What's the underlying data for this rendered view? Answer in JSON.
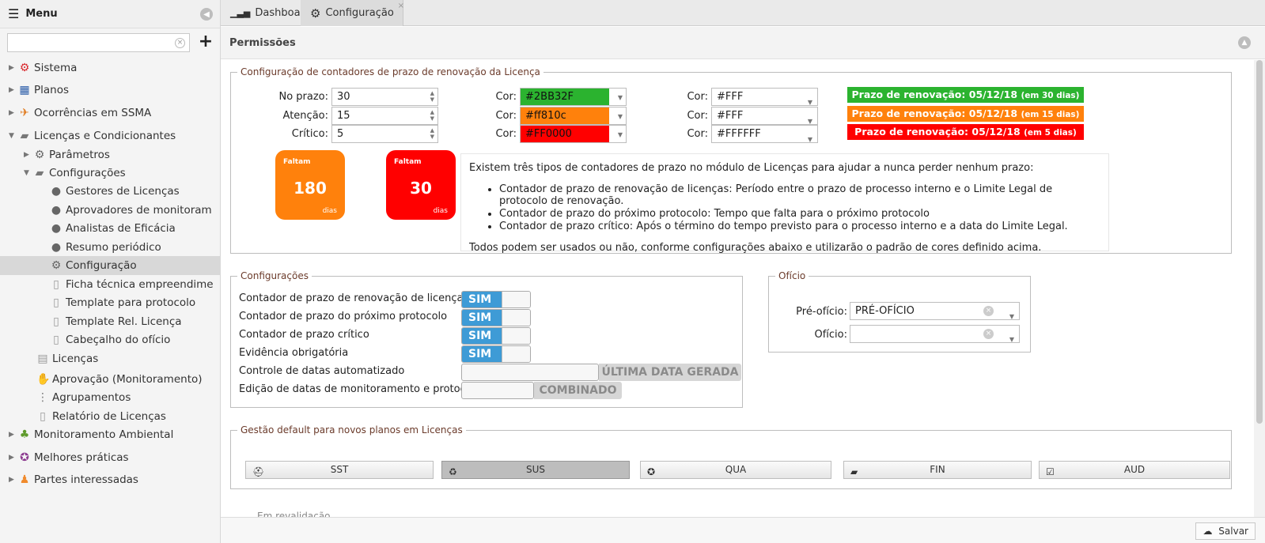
{
  "sidebar": {
    "menu_label": "Menu",
    "search_placeholder": "",
    "items": [
      {
        "label": "Sistema",
        "icon": "gear-red-icon",
        "color": "#d9262b",
        "level": 0,
        "arrow": "right"
      },
      {
        "label": "Planos",
        "icon": "calendar-icon",
        "color": "#2a5ca8",
        "level": 0,
        "arrow": "right"
      },
      {
        "label": "Ocorrências em SSMA",
        "icon": "fall-person-icon",
        "color": "#e07b1f",
        "level": 0,
        "arrow": "right"
      },
      {
        "label": "Licenças e Condicionantes",
        "icon": "folder-open-icon",
        "color": "#777777",
        "level": 0,
        "arrow": "down"
      },
      {
        "label": "Parâmetros",
        "icon": "gear-icon",
        "color": "#666666",
        "level": 1,
        "arrow": "right"
      },
      {
        "label": "Configurações",
        "icon": "folder-open-icon",
        "color": "#777777",
        "level": 1,
        "arrow": "down"
      },
      {
        "label": "Gestores de Licenças",
        "icon": "user-icon",
        "color": "#666666",
        "level": 2
      },
      {
        "label": "Aprovadores de monitoram",
        "icon": "user-icon",
        "color": "#666666",
        "level": 2
      },
      {
        "label": "Analistas de Eficácia",
        "icon": "user-icon",
        "color": "#666666",
        "level": 2
      },
      {
        "label": "Resumo periódico",
        "icon": "user-clock-icon",
        "color": "#666666",
        "level": 2
      },
      {
        "label": "Configuração",
        "icon": "gear-icon",
        "color": "#666666",
        "level": 2,
        "selected": true
      },
      {
        "label": "Ficha técnica empreendime",
        "icon": "pdf-icon",
        "color": "#999999",
        "level": 2
      },
      {
        "label": "Template para protocolo",
        "icon": "pdf-icon",
        "color": "#999999",
        "level": 2
      },
      {
        "label": "Template Rel. Licença",
        "icon": "pdf-icon",
        "color": "#999999",
        "level": 2
      },
      {
        "label": "Cabeçalho do ofício",
        "icon": "pdf-icon",
        "color": "#999999",
        "level": 2
      },
      {
        "label": "Licenças",
        "icon": "license-doc-icon",
        "color": "#999999",
        "level": 1
      },
      {
        "label": "Aprovação (Monitoramento)",
        "icon": "thumbs-up-icon",
        "color": "#777777",
        "level": 1
      },
      {
        "label": "Agrupamentos",
        "icon": "group-icon",
        "color": "#777777",
        "level": 1
      },
      {
        "label": "Relatório de Licenças",
        "icon": "pdf-icon",
        "color": "#999999",
        "level": 1
      },
      {
        "label": "Monitoramento Ambiental",
        "icon": "tree-icon",
        "color": "#5e9a2b",
        "level": 0,
        "arrow": "right"
      },
      {
        "label": "Melhores práticas",
        "icon": "medal-icon",
        "color": "#8b3a8f",
        "level": 0,
        "arrow": "right"
      },
      {
        "label": "Partes interessadas",
        "icon": "people-icon",
        "color": "#f08a2c",
        "level": 0,
        "arrow": "right"
      }
    ]
  },
  "tabs": [
    {
      "label": "Dashboard",
      "icon": "bar-chart-icon"
    },
    {
      "label": "Configuração",
      "icon": "gear-icon",
      "close": "×"
    }
  ],
  "panel": {
    "title": "Permissões"
  },
  "counters": {
    "legend": "Configuração de contadores de prazo de renovação da Licença",
    "rows": [
      {
        "label": "No prazo:",
        "value": "30",
        "cor_label": "Cor:",
        "bg": "#2BB32F",
        "bg_swatch": "#2BB32F",
        "fg": "#FFF",
        "banner": "Prazo de renovação: 05/12/18",
        "banner_small": "(em 30 dias)"
      },
      {
        "label": "Atenção:",
        "value": "15",
        "cor_label": "Cor:",
        "bg": "#ff810c",
        "bg_swatch": "#ff810c",
        "fg": "#FFF",
        "banner": "Prazo de renovação: 05/12/18",
        "banner_small": "(em 15 dias)"
      },
      {
        "label": "Crítico:",
        "value": "5",
        "cor_label": "Cor:",
        "bg": "#FF0000",
        "bg_swatch": "#FF0000",
        "fg": "#FFFFFF",
        "banner": "Prazo de renovação: 05/12/18",
        "banner_small": "(em 5 dias)"
      }
    ],
    "cards": [
      {
        "title": "Faltam",
        "number": "180",
        "unit": "dias",
        "color": "#ff810c"
      },
      {
        "title": "Faltam",
        "number": "30",
        "unit": "dias",
        "color": "#FF0000"
      }
    ],
    "info": {
      "intro": "Existem três tipos de contadores de prazo no módulo de Licenças para ajudar a nunca perder nenhum prazo:",
      "bullets": [
        "Contador de prazo de renovação de licenças: Período entre o prazo de processo interno e o Limite Legal de protocolo de renovação.",
        "Contador de prazo do próximo protocolo: Tempo que falta para o próximo protocolo",
        "Contador de prazo crítico: Após o término do tempo previsto para o processo interno e a data do Limite Legal."
      ],
      "outro": "Todos podem ser usados ou não, conforme configurações abaixo e utilizarão o padrão de cores definido acima."
    }
  },
  "configs": {
    "legend": "Configurações",
    "rows": [
      {
        "label": "Contador de prazo de renovação de licenças",
        "state": "SIM"
      },
      {
        "label": "Contador de prazo do próximo protocolo",
        "state": "SIM"
      },
      {
        "label": "Contador de prazo crítico",
        "state": "SIM"
      },
      {
        "label": "Evidência obrigatória",
        "state": "SIM"
      },
      {
        "label": "Controle de datas automatizado",
        "state": "ÚLTIMA DATA GERADA"
      },
      {
        "label": "Edição de datas de monitoramento e protocolo",
        "state": "COMBINADO"
      }
    ]
  },
  "oficio": {
    "legend": "Ofício",
    "pre_label": "Pré-ofício:",
    "pre_value": "PRÉ-OFÍCIO",
    "of_label": "Ofício:",
    "of_value": ""
  },
  "gestao": {
    "legend": "Gestão default para novos planos em Licenças",
    "buttons": [
      {
        "label": "SST",
        "icon": "helmet-icon",
        "glyph": "⛑",
        "pressed": false
      },
      {
        "label": "SUS",
        "icon": "recycle-icon",
        "glyph": "♻",
        "pressed": true
      },
      {
        "label": "QUA",
        "icon": "award-icon",
        "glyph": "✪",
        "pressed": false
      },
      {
        "label": "FIN",
        "icon": "finance-icon",
        "glyph": "▰",
        "pressed": false
      },
      {
        "label": "AUD",
        "icon": "audit-icon",
        "glyph": "☑",
        "pressed": false
      }
    ]
  },
  "cut_text": "Em revalidação",
  "footer": {
    "save_label": "Salvar"
  }
}
